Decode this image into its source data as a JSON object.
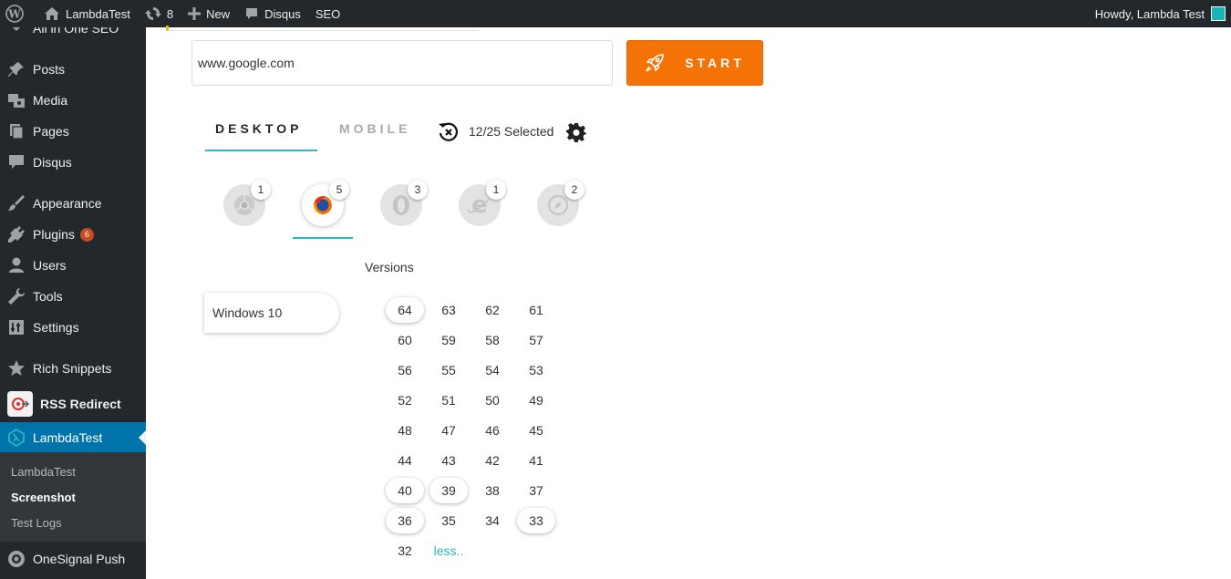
{
  "adminbar": {
    "site_name": "LambdaTest",
    "updates_count": "8",
    "new_label": "New",
    "disqus_label": "Disqus",
    "seo_label": "SEO",
    "greeting": "Howdy, Lambda Test"
  },
  "sidebar": {
    "partial_item": "All in One SEO",
    "items": [
      {
        "label": "Posts",
        "icon": "pin-icon"
      },
      {
        "label": "Media",
        "icon": "media-icon"
      },
      {
        "label": "Pages",
        "icon": "pages-icon"
      },
      {
        "label": "Disqus",
        "icon": "comment-icon"
      },
      {
        "label": "Appearance",
        "icon": "brush-icon"
      },
      {
        "label": "Plugins",
        "icon": "plugin-icon",
        "badge": "6"
      },
      {
        "label": "Users",
        "icon": "user-icon"
      },
      {
        "label": "Tools",
        "icon": "wrench-icon"
      },
      {
        "label": "Settings",
        "icon": "sliders-icon"
      },
      {
        "label": "Rich Snippets",
        "icon": "star-icon"
      },
      {
        "label": "RSS Redirect",
        "icon": "rss-logo"
      },
      {
        "label": "LambdaTest",
        "icon": "lambdatest-icon",
        "active": true
      },
      {
        "label": "OneSignal Push",
        "icon": "onesignal-icon"
      }
    ],
    "submenu": [
      "LambdaTest",
      "Screenshot",
      "Test Logs"
    ],
    "submenu_current": "Screenshot"
  },
  "main": {
    "url_value": "www.google.com",
    "start_label": "START",
    "tabs": [
      "DESKTOP",
      "MOBILE"
    ],
    "active_tab": "DESKTOP",
    "selected_text": "12/25 Selected",
    "browsers": [
      {
        "name": "chrome-icon",
        "count": "1"
      },
      {
        "name": "firefox-icon",
        "count": "5",
        "selected": true
      },
      {
        "name": "opera-icon",
        "count": "3"
      },
      {
        "name": "ie-icon",
        "count": "1"
      },
      {
        "name": "safari-icon",
        "count": "2"
      }
    ],
    "versions_label": "Versions",
    "os": "Windows 10",
    "versions": [
      "64",
      "63",
      "62",
      "61",
      "60",
      "59",
      "58",
      "57",
      "56",
      "55",
      "54",
      "53",
      "52",
      "51",
      "50",
      "49",
      "48",
      "47",
      "46",
      "45",
      "44",
      "43",
      "42",
      "41",
      "40",
      "39",
      "38",
      "37",
      "36",
      "35",
      "34",
      "33",
      "32"
    ],
    "selected_versions": [
      "64",
      "40",
      "39",
      "36",
      "33"
    ],
    "less_link": "less.."
  },
  "colors": {
    "accent": "#29b6c8",
    "start_button": "#f47206",
    "admin_bg": "#23282d",
    "active_menu": "#0073aa"
  }
}
